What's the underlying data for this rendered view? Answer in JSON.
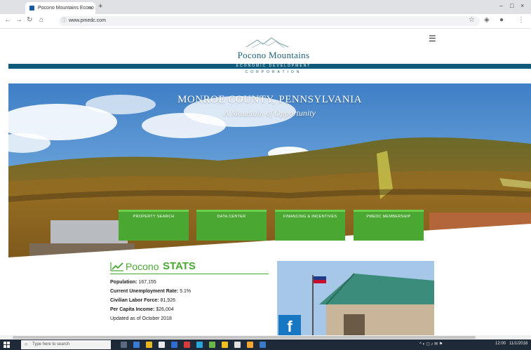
{
  "browser": {
    "tab_title": "Pocono Mountains Econo",
    "tab_close": "×",
    "new_tab": "+",
    "url": "www.pmedc.com",
    "icons": [
      "back-icon",
      "forward-icon",
      "reload-icon",
      "home-icon",
      "star-icon",
      "extensions-icon",
      "account-icon",
      "menu-icon"
    ],
    "window_controls": [
      "–",
      "□",
      "×"
    ]
  },
  "site": {
    "logo_name": "Pocono Mountains",
    "logo_line1": "ECONOMIC DEVELOPMENT",
    "logo_line2": "CORPORATION",
    "menu_icon": "☰",
    "brand_color": "#0f5a7a",
    "accent_color": "#4aa832"
  },
  "hero": {
    "title": "MONROE COUNTY, PENNSYLVANIA",
    "subtitle": "A Mountain of Opportunity",
    "buttons": [
      "PROPERTY SEARCH",
      "DATA CENTER",
      "FINANCING & INCENTIVES",
      "PMEDC MEMBERSHIP"
    ]
  },
  "stats": {
    "title_light": "Pocono",
    "title_bold": "STATS",
    "lines": [
      {
        "label": "Population:",
        "value": "167,155"
      },
      {
        "label": "Current Unemployment Rate:",
        "value": "5.1%"
      },
      {
        "label": "Civilian Labor Force:",
        "value": "81,926"
      },
      {
        "label": "Per Capita Income:",
        "value": "$26,004"
      }
    ],
    "updated": "Updated as of October 2018"
  },
  "social": {
    "facebook_letter": "f"
  },
  "taskbar": {
    "search_placeholder": "Type here to search",
    "time": "12:00",
    "date": "11/1/2018"
  }
}
